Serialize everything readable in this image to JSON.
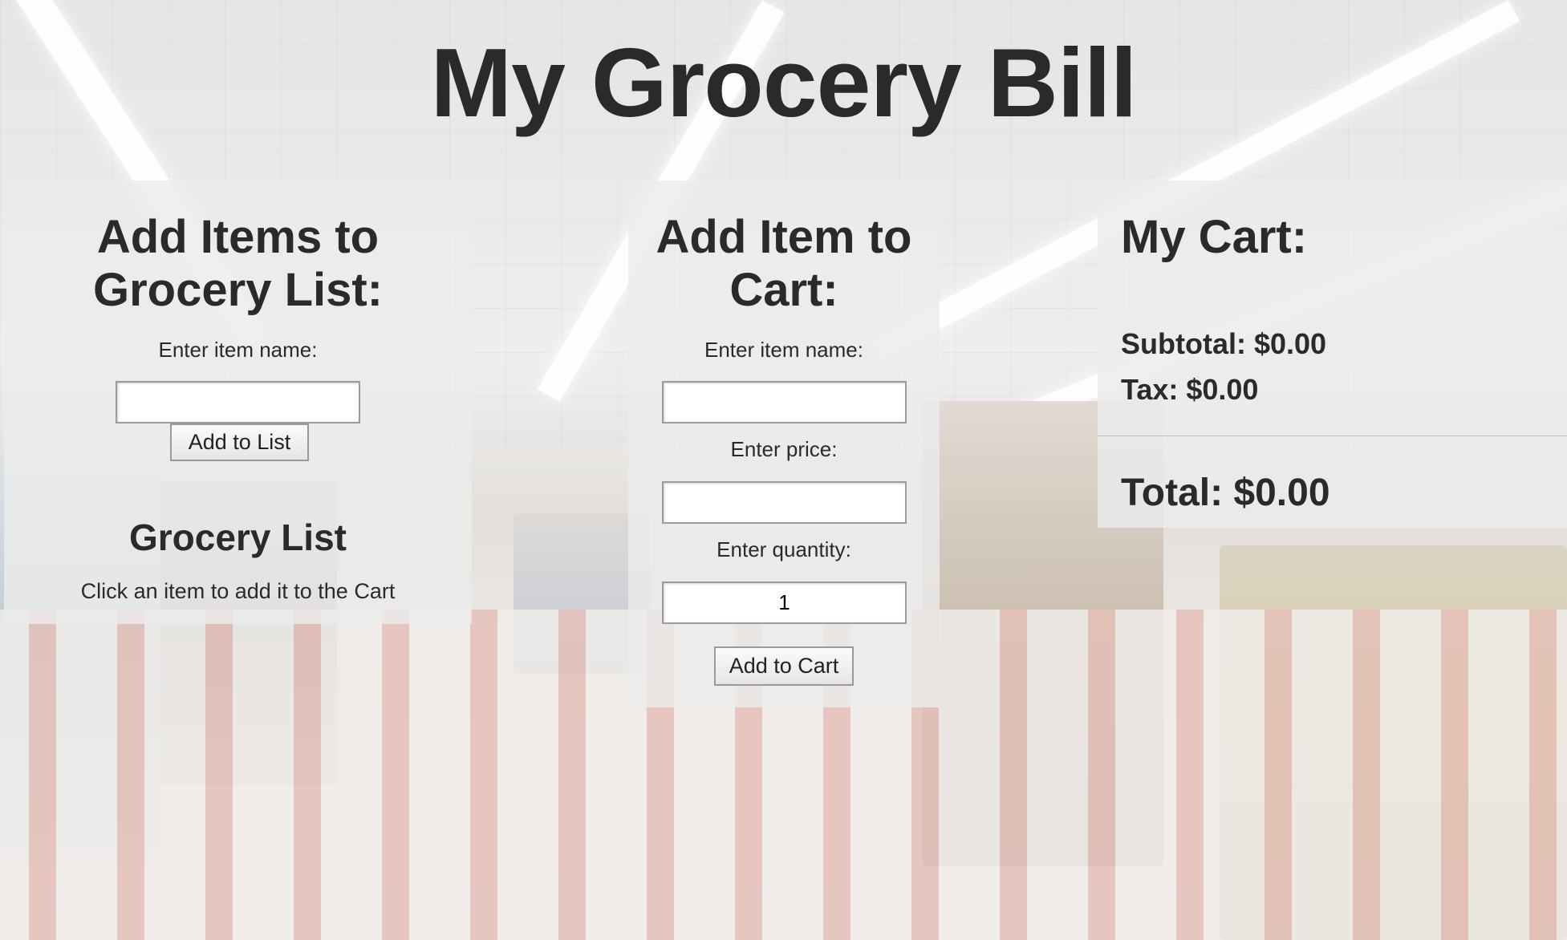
{
  "page": {
    "title": "My Grocery Bill"
  },
  "grocery_list_panel": {
    "heading": "Add Items to Grocery List:",
    "item_name_label": "Enter item name:",
    "item_name_value": "",
    "add_button_label": "Add to List",
    "list_title": "Grocery List",
    "list_hint": "Click an item to add it to the Cart"
  },
  "cart_form_panel": {
    "heading": "Add Item to Cart:",
    "item_name_label": "Enter item name:",
    "item_name_value": "",
    "price_label": "Enter price:",
    "price_value": "",
    "quantity_label": "Enter quantity:",
    "quantity_value": "1",
    "add_button_label": "Add to Cart"
  },
  "cart_panel": {
    "heading": "My Cart:",
    "subtotal": "Subtotal: $0.00",
    "tax": "Tax: $0.00",
    "total": "Total: $0.00"
  },
  "colors": {
    "text": "#2a2a2a",
    "panel_background": "#ececec",
    "input_border": "#9c9c9c"
  }
}
